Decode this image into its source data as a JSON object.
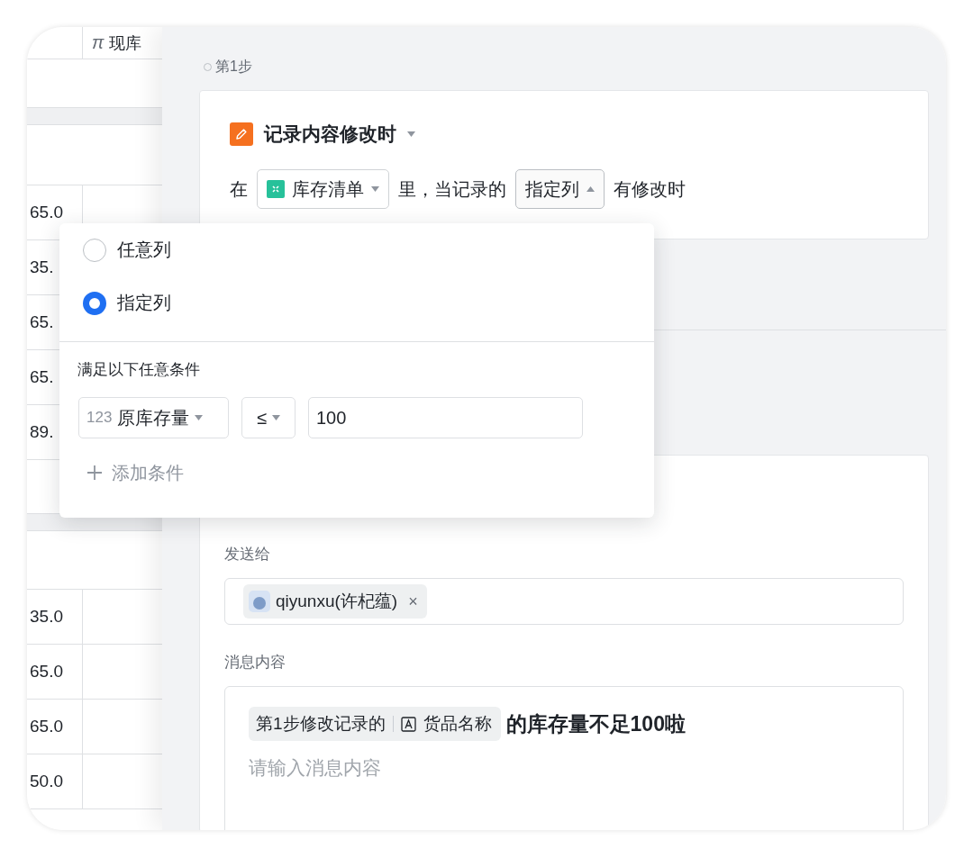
{
  "table": {
    "header": {
      "icon": "π",
      "label": "现库"
    },
    "groups": [
      {
        "rows": [
          "65.0",
          "35.",
          "65.",
          "65.",
          "89."
        ]
      },
      {
        "rows": [
          "35.0",
          "65.0",
          "65.0",
          "50.0"
        ]
      }
    ]
  },
  "step": {
    "label": "第1步"
  },
  "trigger": {
    "title": "记录内容修改时",
    "parts": [
      {
        "kind": "text",
        "text": "在"
      },
      {
        "kind": "table-select",
        "text": "库存清单",
        "expanded": false
      },
      {
        "kind": "text",
        "text": "里，当记录的"
      },
      {
        "kind": "select",
        "text": "指定列",
        "expanded": true
      },
      {
        "kind": "text",
        "text": "有修改时"
      }
    ]
  },
  "popover": {
    "options": [
      {
        "label": "任意列",
        "selected": false
      },
      {
        "label": "指定列",
        "selected": true
      }
    ],
    "conditions_title": "满足以下任意条件",
    "condition": {
      "type_badge": "123",
      "field": "原库存量",
      "operator": "≤",
      "value": "100"
    },
    "add_label": "添加条件"
  },
  "action": {
    "recipients_label": "发送给",
    "recipients": [
      {
        "name": "qiyunxu(许杞蕴)",
        "remove": "×"
      }
    ],
    "message_label": "消息内容",
    "message": [
      {
        "kind": "token",
        "step": "第1步修改记录的",
        "field": "货品名称"
      },
      {
        "kind": "text",
        "text": "的库存量不足100啦"
      }
    ],
    "placeholder": "请输入消息内容"
  }
}
